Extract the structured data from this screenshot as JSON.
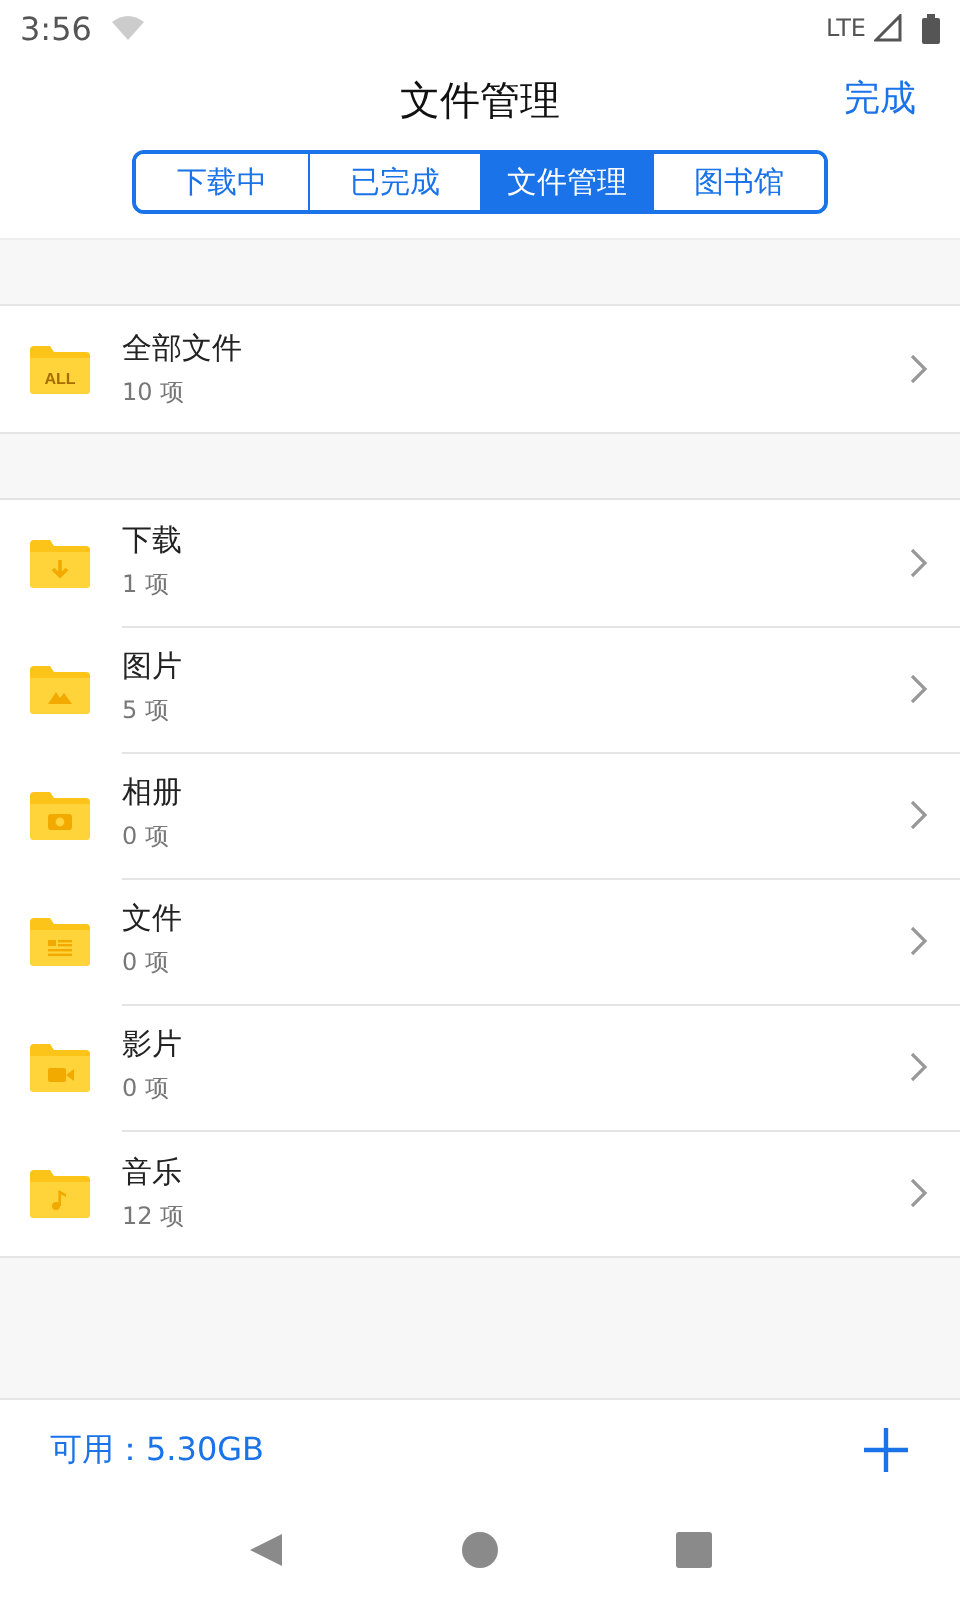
{
  "status_bar": {
    "time": "3:56",
    "network": "LTE"
  },
  "nav": {
    "title": "文件管理",
    "action": "完成"
  },
  "tabs": [
    {
      "label": "下载中",
      "selected": false
    },
    {
      "label": "已完成",
      "selected": false
    },
    {
      "label": "文件管理",
      "selected": true
    },
    {
      "label": "图书馆",
      "selected": false
    }
  ],
  "groups": [
    {
      "items": [
        {
          "name": "全部文件",
          "count": "10 项",
          "kind": "all",
          "badge": "ALL"
        }
      ]
    },
    {
      "items": [
        {
          "name": "下载",
          "count": "1 项",
          "kind": "download"
        },
        {
          "name": "图片",
          "count": "5 项",
          "kind": "image"
        },
        {
          "name": "相册",
          "count": "0 项",
          "kind": "camera"
        },
        {
          "name": "文件",
          "count": "0 项",
          "kind": "document"
        },
        {
          "name": "影片",
          "count": "0 项",
          "kind": "video"
        },
        {
          "name": "音乐",
          "count": "12 项",
          "kind": "music"
        }
      ]
    }
  ],
  "footer": {
    "available": "可用：5.30GB"
  }
}
